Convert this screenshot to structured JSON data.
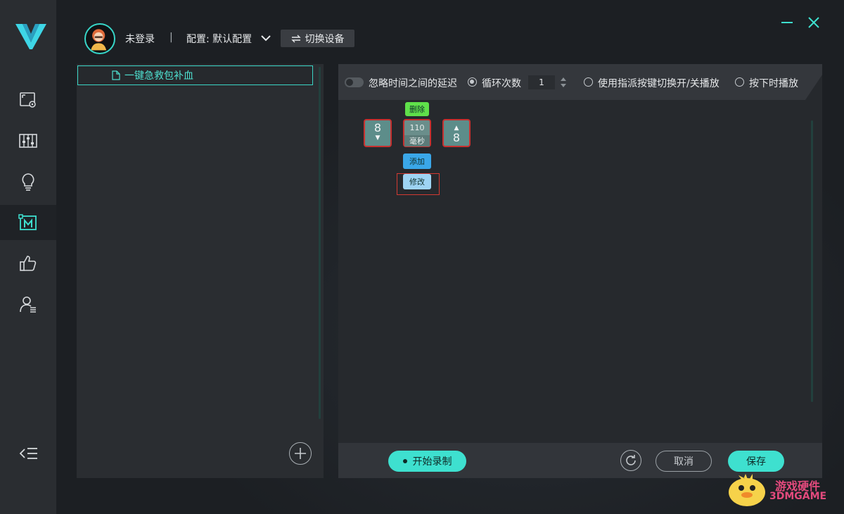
{
  "header": {
    "login_status": "未登录",
    "separator": "|",
    "config_label": "配置: 默认配置",
    "switch_device": "切换设备"
  },
  "sidebar": {
    "items": [
      {
        "icon": "screen-settings-icon"
      },
      {
        "icon": "sliders-icon"
      },
      {
        "icon": "lightbulb-icon"
      },
      {
        "icon": "macro-icon",
        "active": true
      },
      {
        "icon": "thumbs-up-icon"
      },
      {
        "icon": "user-list-icon"
      }
    ]
  },
  "macro_list": {
    "items": [
      {
        "label": "一键急救包补血"
      }
    ]
  },
  "toolbar": {
    "ignore_delay": "忽略时间之间的延迟",
    "loop_count_label": "循环次数",
    "loop_count_value": "1",
    "assign_key_toggle": "使用指派按键切换开/关播放",
    "press_play": "按下时播放"
  },
  "macro_editor": {
    "key_down": "8",
    "key_up": "8",
    "delay_value": "110",
    "delay_unit": "毫秒",
    "delete_label": "删除",
    "add_label": "添加",
    "modify_label": "修改"
  },
  "bottom": {
    "record": "开始录制",
    "cancel": "取消",
    "save": "保存"
  },
  "watermark": {
    "line1": "游戏硬件",
    "line2": "3DMGAME"
  },
  "colors": {
    "accent": "#3ee0cf",
    "delete_green": "#5fe04a",
    "add_blue": "#3aa7e8",
    "modify_blue": "#9ed4f4",
    "error_red": "#c8302f"
  }
}
